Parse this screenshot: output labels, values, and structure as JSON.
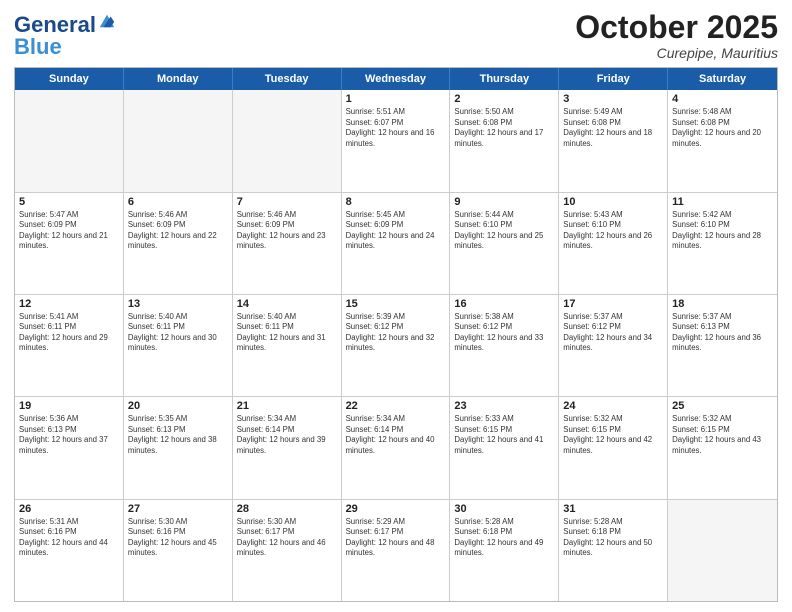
{
  "header": {
    "logo": {
      "line1": "General",
      "line2": "Blue"
    },
    "title": "October 2025",
    "location": "Curepipe, Mauritius"
  },
  "weekdays": [
    "Sunday",
    "Monday",
    "Tuesday",
    "Wednesday",
    "Thursday",
    "Friday",
    "Saturday"
  ],
  "rows": [
    [
      {
        "day": "",
        "empty": true
      },
      {
        "day": "",
        "empty": true
      },
      {
        "day": "",
        "empty": true
      },
      {
        "day": "1",
        "sunrise": "Sunrise: 5:51 AM",
        "sunset": "Sunset: 6:07 PM",
        "daylight": "Daylight: 12 hours and 16 minutes."
      },
      {
        "day": "2",
        "sunrise": "Sunrise: 5:50 AM",
        "sunset": "Sunset: 6:08 PM",
        "daylight": "Daylight: 12 hours and 17 minutes."
      },
      {
        "day": "3",
        "sunrise": "Sunrise: 5:49 AM",
        "sunset": "Sunset: 6:08 PM",
        "daylight": "Daylight: 12 hours and 18 minutes."
      },
      {
        "day": "4",
        "sunrise": "Sunrise: 5:48 AM",
        "sunset": "Sunset: 6:08 PM",
        "daylight": "Daylight: 12 hours and 20 minutes."
      }
    ],
    [
      {
        "day": "5",
        "sunrise": "Sunrise: 5:47 AM",
        "sunset": "Sunset: 6:09 PM",
        "daylight": "Daylight: 12 hours and 21 minutes."
      },
      {
        "day": "6",
        "sunrise": "Sunrise: 5:46 AM",
        "sunset": "Sunset: 6:09 PM",
        "daylight": "Daylight: 12 hours and 22 minutes."
      },
      {
        "day": "7",
        "sunrise": "Sunrise: 5:46 AM",
        "sunset": "Sunset: 6:09 PM",
        "daylight": "Daylight: 12 hours and 23 minutes."
      },
      {
        "day": "8",
        "sunrise": "Sunrise: 5:45 AM",
        "sunset": "Sunset: 6:09 PM",
        "daylight": "Daylight: 12 hours and 24 minutes."
      },
      {
        "day": "9",
        "sunrise": "Sunrise: 5:44 AM",
        "sunset": "Sunset: 6:10 PM",
        "daylight": "Daylight: 12 hours and 25 minutes."
      },
      {
        "day": "10",
        "sunrise": "Sunrise: 5:43 AM",
        "sunset": "Sunset: 6:10 PM",
        "daylight": "Daylight: 12 hours and 26 minutes."
      },
      {
        "day": "11",
        "sunrise": "Sunrise: 5:42 AM",
        "sunset": "Sunset: 6:10 PM",
        "daylight": "Daylight: 12 hours and 28 minutes."
      }
    ],
    [
      {
        "day": "12",
        "sunrise": "Sunrise: 5:41 AM",
        "sunset": "Sunset: 6:11 PM",
        "daylight": "Daylight: 12 hours and 29 minutes."
      },
      {
        "day": "13",
        "sunrise": "Sunrise: 5:40 AM",
        "sunset": "Sunset: 6:11 PM",
        "daylight": "Daylight: 12 hours and 30 minutes."
      },
      {
        "day": "14",
        "sunrise": "Sunrise: 5:40 AM",
        "sunset": "Sunset: 6:11 PM",
        "daylight": "Daylight: 12 hours and 31 minutes."
      },
      {
        "day": "15",
        "sunrise": "Sunrise: 5:39 AM",
        "sunset": "Sunset: 6:12 PM",
        "daylight": "Daylight: 12 hours and 32 minutes."
      },
      {
        "day": "16",
        "sunrise": "Sunrise: 5:38 AM",
        "sunset": "Sunset: 6:12 PM",
        "daylight": "Daylight: 12 hours and 33 minutes."
      },
      {
        "day": "17",
        "sunrise": "Sunrise: 5:37 AM",
        "sunset": "Sunset: 6:12 PM",
        "daylight": "Daylight: 12 hours and 34 minutes."
      },
      {
        "day": "18",
        "sunrise": "Sunrise: 5:37 AM",
        "sunset": "Sunset: 6:13 PM",
        "daylight": "Daylight: 12 hours and 36 minutes."
      }
    ],
    [
      {
        "day": "19",
        "sunrise": "Sunrise: 5:36 AM",
        "sunset": "Sunset: 6:13 PM",
        "daylight": "Daylight: 12 hours and 37 minutes."
      },
      {
        "day": "20",
        "sunrise": "Sunrise: 5:35 AM",
        "sunset": "Sunset: 6:13 PM",
        "daylight": "Daylight: 12 hours and 38 minutes."
      },
      {
        "day": "21",
        "sunrise": "Sunrise: 5:34 AM",
        "sunset": "Sunset: 6:14 PM",
        "daylight": "Daylight: 12 hours and 39 minutes."
      },
      {
        "day": "22",
        "sunrise": "Sunrise: 5:34 AM",
        "sunset": "Sunset: 6:14 PM",
        "daylight": "Daylight: 12 hours and 40 minutes."
      },
      {
        "day": "23",
        "sunrise": "Sunrise: 5:33 AM",
        "sunset": "Sunset: 6:15 PM",
        "daylight": "Daylight: 12 hours and 41 minutes."
      },
      {
        "day": "24",
        "sunrise": "Sunrise: 5:32 AM",
        "sunset": "Sunset: 6:15 PM",
        "daylight": "Daylight: 12 hours and 42 minutes."
      },
      {
        "day": "25",
        "sunrise": "Sunrise: 5:32 AM",
        "sunset": "Sunset: 6:15 PM",
        "daylight": "Daylight: 12 hours and 43 minutes."
      }
    ],
    [
      {
        "day": "26",
        "sunrise": "Sunrise: 5:31 AM",
        "sunset": "Sunset: 6:16 PM",
        "daylight": "Daylight: 12 hours and 44 minutes."
      },
      {
        "day": "27",
        "sunrise": "Sunrise: 5:30 AM",
        "sunset": "Sunset: 6:16 PM",
        "daylight": "Daylight: 12 hours and 45 minutes."
      },
      {
        "day": "28",
        "sunrise": "Sunrise: 5:30 AM",
        "sunset": "Sunset: 6:17 PM",
        "daylight": "Daylight: 12 hours and 46 minutes."
      },
      {
        "day": "29",
        "sunrise": "Sunrise: 5:29 AM",
        "sunset": "Sunset: 6:17 PM",
        "daylight": "Daylight: 12 hours and 48 minutes."
      },
      {
        "day": "30",
        "sunrise": "Sunrise: 5:28 AM",
        "sunset": "Sunset: 6:18 PM",
        "daylight": "Daylight: 12 hours and 49 minutes."
      },
      {
        "day": "31",
        "sunrise": "Sunrise: 5:28 AM",
        "sunset": "Sunset: 6:18 PM",
        "daylight": "Daylight: 12 hours and 50 minutes."
      },
      {
        "day": "",
        "empty": true
      }
    ]
  ]
}
